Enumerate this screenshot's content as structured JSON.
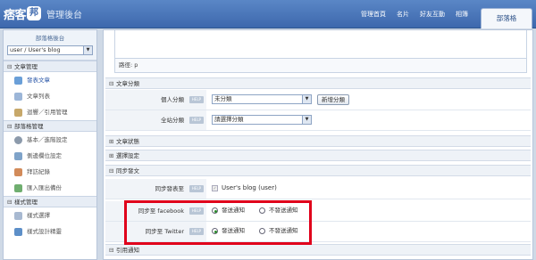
{
  "header": {
    "logo_text": "痞客",
    "logo_badge": "邦",
    "subtitle": "管理後台",
    "nav": [
      "管理首頁",
      "名片",
      "好友互動",
      "相簿"
    ],
    "active_tab": "部落格"
  },
  "sidebar": {
    "title": "部落格後台",
    "blog_select": "user / User's blog",
    "sections": [
      {
        "label": "文章管理",
        "items": [
          "發表文章",
          "文章列表",
          "迴響／引用管理"
        ]
      },
      {
        "label": "部落格管理",
        "items": [
          "基本／進階設定",
          "側邊欄位設定",
          "拜訪紀錄",
          "匯入匯出備份"
        ]
      },
      {
        "label": "樣式管理",
        "items": [
          "樣式選擇",
          "樣式設計精靈"
        ]
      }
    ]
  },
  "main": {
    "path_label": "路徑:",
    "path_value": "p",
    "category_section": "文章分類",
    "personal_category_label": "個人分類",
    "personal_category_value": "未分類",
    "new_category_button": "新增分類",
    "site_category_label": "全站分類",
    "site_category_value": "請選擇分類",
    "status_section": "文章狀態",
    "options_section": "選擇設定",
    "sync_section": "同步發文",
    "sync_post_label": "同步發表至",
    "sync_post_value": "User's blog (user)",
    "fb_label": "同步至 facebook",
    "twitter_label": "同步至 Twitter",
    "notify_on": "發送通知",
    "notify_off": "不發送通知",
    "trackback_section": "引用通知",
    "help": "HELP"
  }
}
